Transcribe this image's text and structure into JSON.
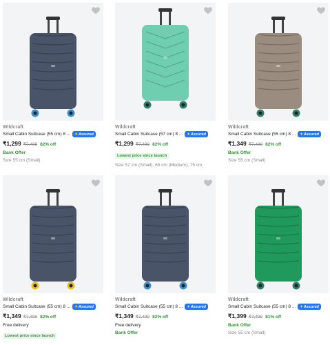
{
  "products": [
    {
      "brand": "Wildcraft",
      "title": "Small Cabin Suitcase (55 cm) 8 ...",
      "assured": "Assured",
      "price": "₹1,299",
      "mrp": "₹7,499",
      "discount": "82% off",
      "offer": "Bank Offer",
      "badge": "",
      "delivery": "",
      "size": "Size 55 cm (Small)",
      "color": "#4a5468",
      "accent": "#3a8fd0",
      "heart_color": "#c2c2c2"
    },
    {
      "brand": "Wildcraft",
      "title": "Small Cabin Suitcase (57 cm) 8 ...",
      "assured": "Assured",
      "price": "₹1,299",
      "mrp": "₹7,499",
      "discount": "82% off",
      "offer": "",
      "badge": "Lowest price since launch",
      "delivery": "",
      "size": "Size 57 cm (Small), 65 cm (Medium), 75 cm",
      "color": "#6fcdb0",
      "accent": "#2f7f6a",
      "heart_color": "#c2c2c2"
    },
    {
      "brand": "Wildcraft",
      "title": "Small Cabin Suitcase (55 cm) 8 ...",
      "assured": "Assured",
      "price": "₹1,349",
      "mrp": "₹7,499",
      "discount": "82% off",
      "offer": "Bank Offer",
      "badge": "",
      "delivery": "",
      "size": "Size 55 cm (Small)",
      "color": "#9b8c80",
      "accent": "#2f7f6a",
      "heart_color": "#c2c2c2"
    },
    {
      "brand": "Wildcraft",
      "title": "Small Cabin Suitcase (55 cm) 8 ...",
      "assured": "Assured",
      "price": "₹1,349",
      "mrp": "₹7,499",
      "discount": "82% off",
      "offer": "",
      "badge": "Lowest price since launch",
      "delivery": "Free delivery",
      "size": "",
      "color": "#4a5468",
      "accent": "#e6c21a",
      "heart_color": "#c2c2c2"
    },
    {
      "brand": "Wildcraft",
      "title": "Small Cabin Suitcase (55 cm) 8 ...",
      "assured": "Assured",
      "price": "₹1,349",
      "mrp": "₹7,499",
      "discount": "82% off",
      "offer": "Bank Offer",
      "badge": "",
      "delivery": "Free delivery",
      "size": "",
      "color": "#4a5468",
      "accent": "#3a8fd0",
      "heart_color": "#c2c2c2"
    },
    {
      "brand": "Wildcraft",
      "title": "Small Cabin Suitcase (55 cm) 8 ...",
      "assured": "Assured",
      "price": "₹1,399",
      "mrp": "₹7,499",
      "discount": "81% off",
      "offer": "Bank Offer",
      "badge": "",
      "delivery": "",
      "size": "Size 55 cm (Small)",
      "color": "#1f9a5c",
      "accent": "#2f7f6a",
      "heart_color": "#c2c2c2"
    }
  ]
}
